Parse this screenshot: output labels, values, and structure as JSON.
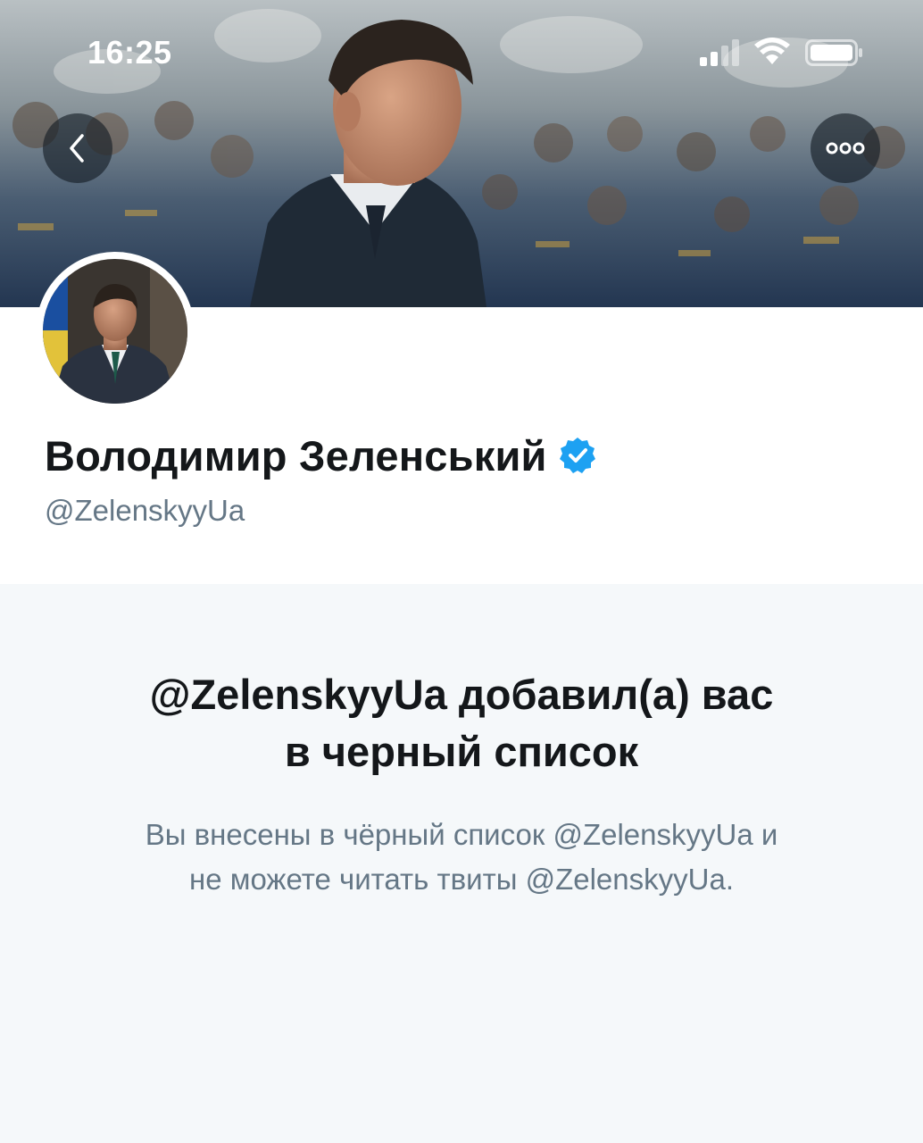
{
  "status_bar": {
    "time": "16:25",
    "signal_icon": "cellular-signal-icon",
    "wifi_icon": "wifi-icon",
    "battery_icon": "battery-icon"
  },
  "header": {
    "back_icon": "chevron-left-icon",
    "more_icon": "more-dots-icon"
  },
  "profile": {
    "display_name": "Володимир Зеленський",
    "handle": "@ZelenskyyUa",
    "verified_icon": "verified-badge-icon"
  },
  "blocked": {
    "title_line1": "@ZelenskyyUa добавил(а) вас",
    "title_line2": "в черный список",
    "desc_line1": "Вы внесены в чёрный список @ZelenskyyUa и",
    "desc_line2": "не можете читать твиты @ZelenskyyUa."
  },
  "colors": {
    "verified": "#1da1f2",
    "name_text": "#14171a",
    "secondary_text": "#657786",
    "notice_background": "#f5f8fa"
  }
}
